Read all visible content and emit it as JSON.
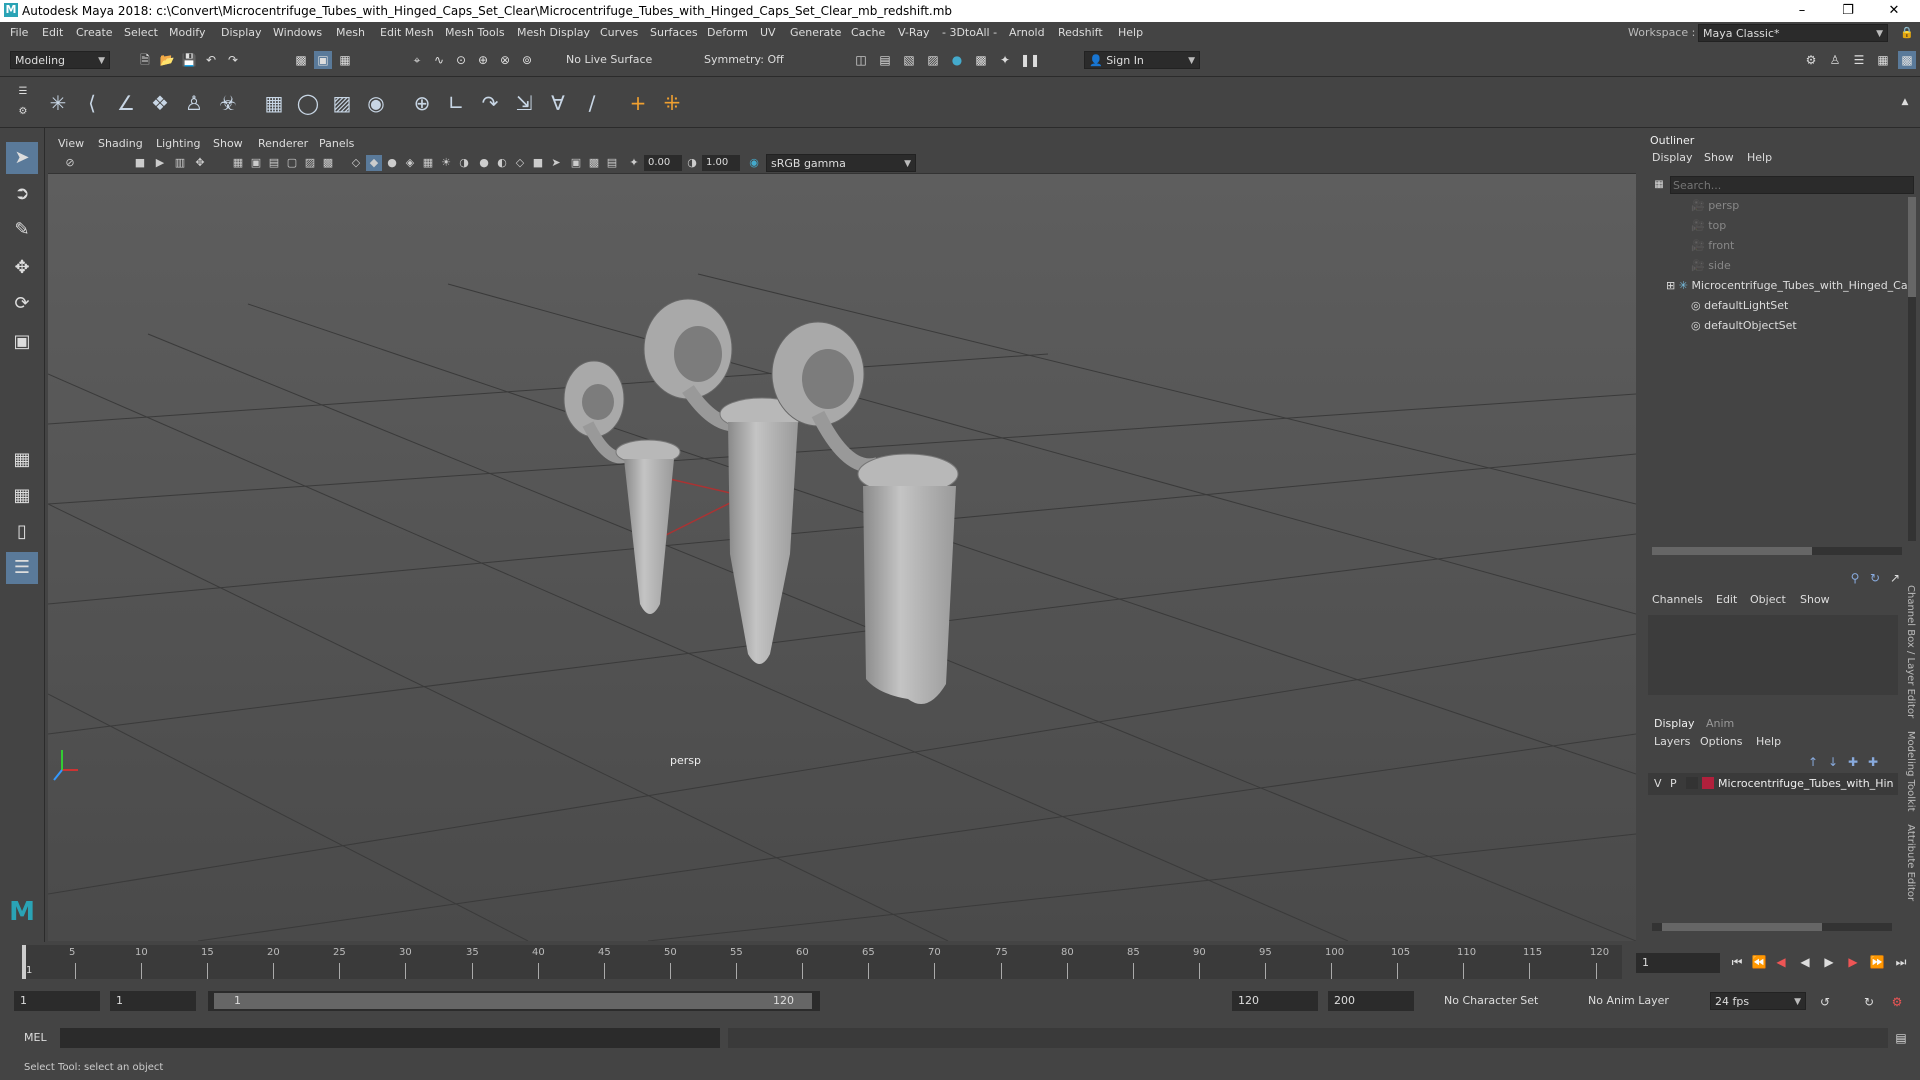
{
  "window": {
    "title": "Autodesk Maya 2018: c:\\Convert\\Microcentrifuge_Tubes_with_Hinged_Caps_Set_Clear\\Microcentrifuge_Tubes_with_Hinged_Caps_Set_Clear_mb_redshift.mb",
    "logo": "M"
  },
  "menubar": {
    "items": [
      "File",
      "Edit",
      "Create",
      "Select",
      "Modify",
      "Display",
      "Windows",
      "Mesh",
      "Edit Mesh",
      "Mesh Tools",
      "Mesh Display",
      "Curves",
      "Surfaces",
      "Deform",
      "UV",
      "Generate",
      "Cache",
      "V-Ray",
      "- 3DtoAll -",
      "Arnold",
      "Redshift",
      "Help"
    ],
    "workspace_label": "Workspace :",
    "workspace_value": "Maya Classic*"
  },
  "statusline": {
    "mode": "Modeling",
    "live_surface": "No Live Surface",
    "symmetry": "Symmetry: Off",
    "sign_in": "Sign In"
  },
  "viewport": {
    "menu": [
      "View",
      "Shading",
      "Lighting",
      "Show",
      "Renderer",
      "Panels"
    ],
    "exposure": "0.00",
    "gamma": "1.00",
    "color_space": "sRGB gamma",
    "camera_label": "persp"
  },
  "outliner": {
    "title": "Outliner",
    "menu": [
      "Display",
      "Show",
      "Help"
    ],
    "search_placeholder": "Search...",
    "items": [
      {
        "label": "persp",
        "type": "camera"
      },
      {
        "label": "top",
        "type": "camera"
      },
      {
        "label": "front",
        "type": "camera"
      },
      {
        "label": "side",
        "type": "camera"
      },
      {
        "label": "Microcentrifuge_Tubes_with_Hinged_Ca",
        "type": "group"
      },
      {
        "label": "defaultLightSet",
        "type": "set"
      },
      {
        "label": "defaultObjectSet",
        "type": "set"
      }
    ]
  },
  "channelbox": {
    "menu": [
      "Channels",
      "Edit",
      "Object",
      "Show"
    ],
    "side_tabs": [
      "Channel Box / Layer Editor",
      "Modeling Toolkit",
      "Attribute Editor"
    ]
  },
  "layers": {
    "tabs": [
      "Display",
      "Anim"
    ],
    "menu": [
      "Layers",
      "Options",
      "Help"
    ],
    "layer": {
      "v": "V",
      "p": "P",
      "name": "Microcentrifuge_Tubes_with_Hin",
      "color": "#b0203c"
    }
  },
  "timeline": {
    "ticks": [
      "5",
      "10",
      "15",
      "20",
      "25",
      "30",
      "35",
      "40",
      "45",
      "50",
      "55",
      "60",
      "65",
      "70",
      "75",
      "80",
      "85",
      "90",
      "95",
      "100",
      "105",
      "110",
      "115",
      "120"
    ],
    "current_frame_marker": "1",
    "current_frame": "1"
  },
  "range": {
    "start": "1",
    "start_inner": "1",
    "slider_start": "1",
    "slider_end": "120",
    "end_inner": "120",
    "end": "200",
    "character_set": "No Character Set",
    "anim_layer": "No Anim Layer",
    "fps": "24 fps"
  },
  "command": {
    "label": "MEL"
  },
  "help": {
    "text": "Select Tool: select an object"
  }
}
